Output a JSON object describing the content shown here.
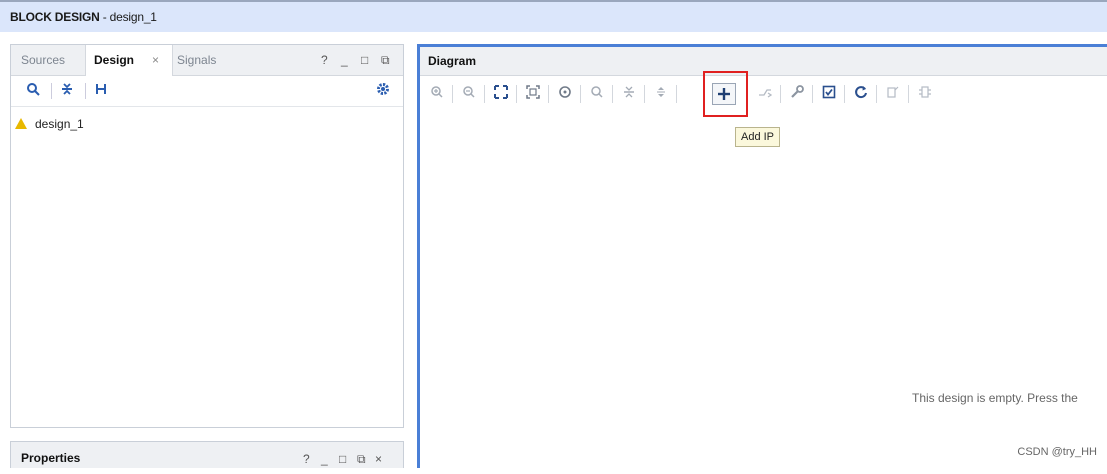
{
  "window": {
    "title_bold": "BLOCK DESIGN",
    "title_rest": " - design_1"
  },
  "left_panel": {
    "tabs": [
      {
        "label": "Sources"
      },
      {
        "label": "Design",
        "close": "×"
      },
      {
        "label": "Signals"
      }
    ],
    "controls": {
      "help": "?",
      "minimize": "_",
      "maximize": "□",
      "float": "⧉"
    },
    "toolbar_icons": [
      "search-icon",
      "collapse-all-icon",
      "expand-all-icon",
      "gear-icon"
    ],
    "tree": [
      {
        "label": "design_1",
        "icon": "warning-icon"
      }
    ]
  },
  "properties_panel": {
    "title": "Properties",
    "controls": {
      "help": "?",
      "minimize": "_",
      "maximize": "□",
      "float": "⧉",
      "close": "×"
    }
  },
  "diagram": {
    "title": "Diagram",
    "toolbar_icons": [
      "zoom-in-icon",
      "zoom-out-icon",
      "fit-full-icon",
      "fit-selection-icon",
      "center-icon",
      "search-icon",
      "collapse-icon",
      "expand-icon",
      "add-ip-icon",
      "route-icon",
      "wrench-icon",
      "validate-icon",
      "refresh-icon",
      "regenerate-icon",
      "ports-icon"
    ],
    "tooltip": "Add IP",
    "empty_message": "This design is empty. Press the"
  },
  "watermark": "CSDN @try_HH",
  "colors": {
    "title_bar": "#dbe6fb",
    "diagram_border": "#4a7fd6",
    "highlight": "#e02020",
    "tooltip_bg": "#fbf8dc"
  }
}
